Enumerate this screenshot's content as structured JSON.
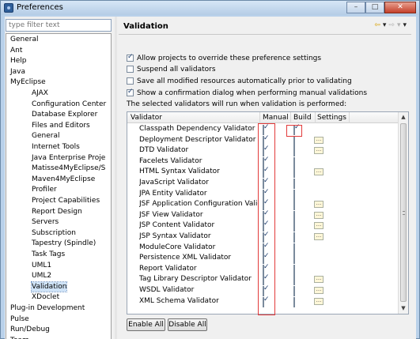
{
  "window": {
    "title": "Preferences"
  },
  "filter": {
    "placeholder": "type filter text"
  },
  "tree": [
    {
      "label": "General",
      "level": 0
    },
    {
      "label": "Ant",
      "level": 0
    },
    {
      "label": "Help",
      "level": 0
    },
    {
      "label": "Java",
      "level": 0
    },
    {
      "label": "MyEclipse",
      "level": 0
    },
    {
      "label": "AJAX",
      "level": 1
    },
    {
      "label": "Configuration Center",
      "level": 1
    },
    {
      "label": "Database Explorer",
      "level": 1
    },
    {
      "label": "Files and Editors",
      "level": 1
    },
    {
      "label": "General",
      "level": 1
    },
    {
      "label": "Internet Tools",
      "level": 1
    },
    {
      "label": "Java Enterprise Proje",
      "level": 1
    },
    {
      "label": "Matisse4MyEclipse/S",
      "level": 1
    },
    {
      "label": "Maven4MyEclipse",
      "level": 1
    },
    {
      "label": "Profiler",
      "level": 1
    },
    {
      "label": "Project Capabilities",
      "level": 1
    },
    {
      "label": "Report Design",
      "level": 1
    },
    {
      "label": "Servers",
      "level": 1
    },
    {
      "label": "Subscription",
      "level": 1
    },
    {
      "label": "Tapestry (Spindle)",
      "level": 1
    },
    {
      "label": "Task Tags",
      "level": 1
    },
    {
      "label": "UML1",
      "level": 1
    },
    {
      "label": "UML2",
      "level": 1
    },
    {
      "label": "Validation",
      "level": 1,
      "selected": true
    },
    {
      "label": "XDoclet",
      "level": 1
    },
    {
      "label": "Plug-in Development",
      "level": 0
    },
    {
      "label": "Pulse",
      "level": 0
    },
    {
      "label": "Run/Debug",
      "level": 0
    },
    {
      "label": "Team",
      "level": 0
    }
  ],
  "panel": {
    "title": "Validation",
    "options": [
      {
        "label": "Allow projects to override these preference settings",
        "checked": true
      },
      {
        "label": "Suspend all validators",
        "checked": false
      },
      {
        "label": "Save all modified resources automatically prior to validating",
        "checked": false
      },
      {
        "label": "Show a confirmation dialog when performing manual validations",
        "checked": true
      }
    ],
    "info": "The selected validators will run when validation is performed:",
    "columns": {
      "validator": "Validator",
      "manual": "Manual",
      "build": "Build",
      "settings": "Settings"
    },
    "validators": [
      {
        "name": "Classpath Dependency Validator",
        "manual": true,
        "build": true,
        "settings": false
      },
      {
        "name": "Deployment Descriptor Validator",
        "manual": true,
        "build": false,
        "settings": true
      },
      {
        "name": "DTD Validator",
        "manual": true,
        "build": false,
        "settings": true
      },
      {
        "name": "Facelets Validator",
        "manual": true,
        "build": false,
        "settings": false
      },
      {
        "name": "HTML Syntax Validator",
        "manual": true,
        "build": false,
        "settings": true
      },
      {
        "name": "JavaScript Validator",
        "manual": true,
        "build": false,
        "settings": false
      },
      {
        "name": "JPA Entity Validator",
        "manual": true,
        "build": false,
        "settings": false
      },
      {
        "name": "JSF Application Configuration Valida...",
        "manual": true,
        "build": false,
        "settings": true
      },
      {
        "name": "JSF View Validator",
        "manual": true,
        "build": false,
        "settings": true
      },
      {
        "name": "JSP Content Validator",
        "manual": true,
        "build": false,
        "settings": true
      },
      {
        "name": "JSP Syntax Validator",
        "manual": true,
        "build": false,
        "settings": true
      },
      {
        "name": "ModuleCore Validator",
        "manual": true,
        "build": false,
        "settings": false
      },
      {
        "name": "Persistence XML Validator",
        "manual": true,
        "build": false,
        "settings": false
      },
      {
        "name": "Report Validator",
        "manual": true,
        "build": false,
        "settings": false
      },
      {
        "name": "Tag Library Descriptor Validator",
        "manual": true,
        "build": false,
        "settings": true
      },
      {
        "name": "WSDL Validator",
        "manual": true,
        "build": false,
        "settings": true
      },
      {
        "name": "XML Schema Validator",
        "manual": true,
        "build": false,
        "settings": true
      }
    ],
    "buttons": {
      "enable_all": "Enable All",
      "disable_all": "Disable All"
    }
  },
  "colors": {
    "highlight": "#e23a3a",
    "selection": "#cfe3f7",
    "nav_arrow": "#d9a000"
  },
  "icons": {
    "back": "back-arrow-icon",
    "forward": "forward-arrow-icon",
    "menu": "view-menu-icon"
  }
}
